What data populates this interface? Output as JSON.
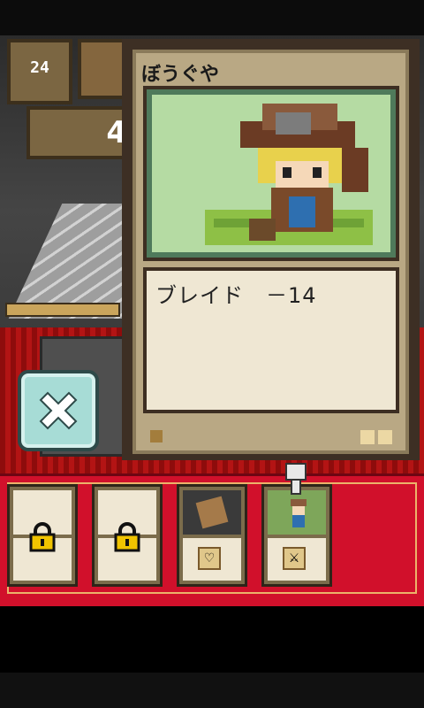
{
  "hud": {
    "level": "24",
    "gold_digit": "4"
  },
  "card": {
    "title": "ぼうぐや",
    "description": "ブレイド　－14",
    "rarity_pips": 2
  },
  "tray": {
    "slots": [
      {
        "name": "locked-1",
        "locked": true
      },
      {
        "name": "locked-2",
        "locked": true
      },
      {
        "name": "scroll",
        "locked": false,
        "badge_icon": "heart-bubble-icon"
      },
      {
        "name": "adventurer",
        "locked": false,
        "badge_icon": "sword-icon"
      }
    ]
  },
  "colors": {
    "tray_red": "#d1102b",
    "card_bg": "#b9a884",
    "close_button": "#a7dcd6"
  }
}
